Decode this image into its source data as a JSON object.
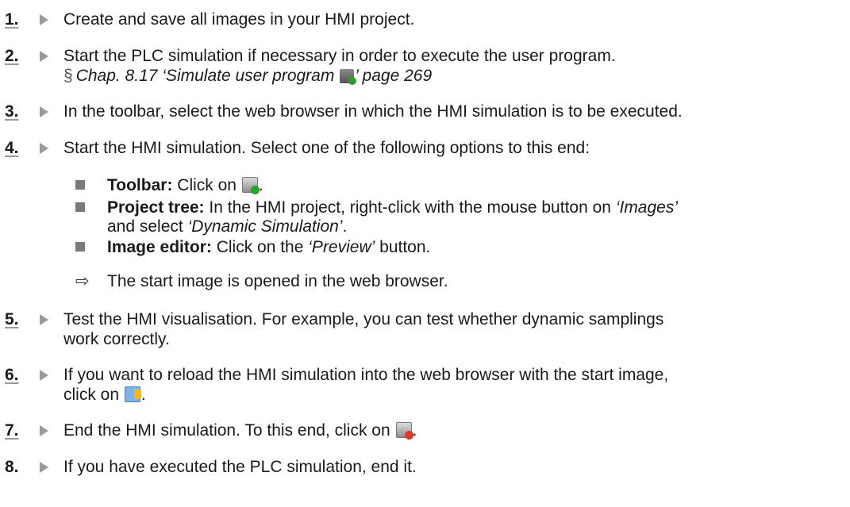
{
  "steps": [
    {
      "num": "1.",
      "text": "Create and save all images in your HMI project."
    },
    {
      "num": "2.",
      "text": "Start the PLC simulation if necessary in order to execute the user program.",
      "ref_symbol": "§",
      "ref_text": "Chap. 8.17 ‘Simulate user program",
      "ref_icon": "plc-simulation-icon",
      "ref_end": "’ page 269"
    },
    {
      "num": "3.",
      "text": "In the toolbar, select the web browser in which the HMI simulation is to be executed."
    },
    {
      "num": "4.",
      "text": "Start the HMI simulation. Select one of the following options to this end:"
    },
    {
      "num": "5.",
      "text": "Test the HMI visualisation. For example, you can test whether dynamic samplings",
      "text2": "work correctly."
    },
    {
      "num": "6.",
      "text": "If you want to reload the HMI simulation into the web browser with the start image,",
      "text2_a": "click on",
      "text2_icon": "reload-icon",
      "text2_b": "."
    },
    {
      "num": "7.",
      "text_a": "End the HMI simulation. To this end, click on",
      "icon": "stop-simulation-icon",
      "text_b": "."
    },
    {
      "num": "8.",
      "text": "If you have executed the PLC simulation, end it."
    }
  ],
  "options": [
    {
      "label": "Toolbar:",
      "text": "Click on",
      "icon": "start-simulation-icon",
      "end": "."
    },
    {
      "label": "Project tree:",
      "text_a": "In the HMI project, right-click with the mouse button on",
      "q1": "‘Images’",
      "text_b": "and select",
      "q2": "‘Dynamic Simulation’",
      "end": "."
    },
    {
      "label": "Image editor:",
      "text_a": "Click on the",
      "q1": "‘Preview’",
      "text_b": "button."
    }
  ],
  "result": {
    "symbol": "⇨",
    "text": "The start image is opened in the web browser."
  }
}
